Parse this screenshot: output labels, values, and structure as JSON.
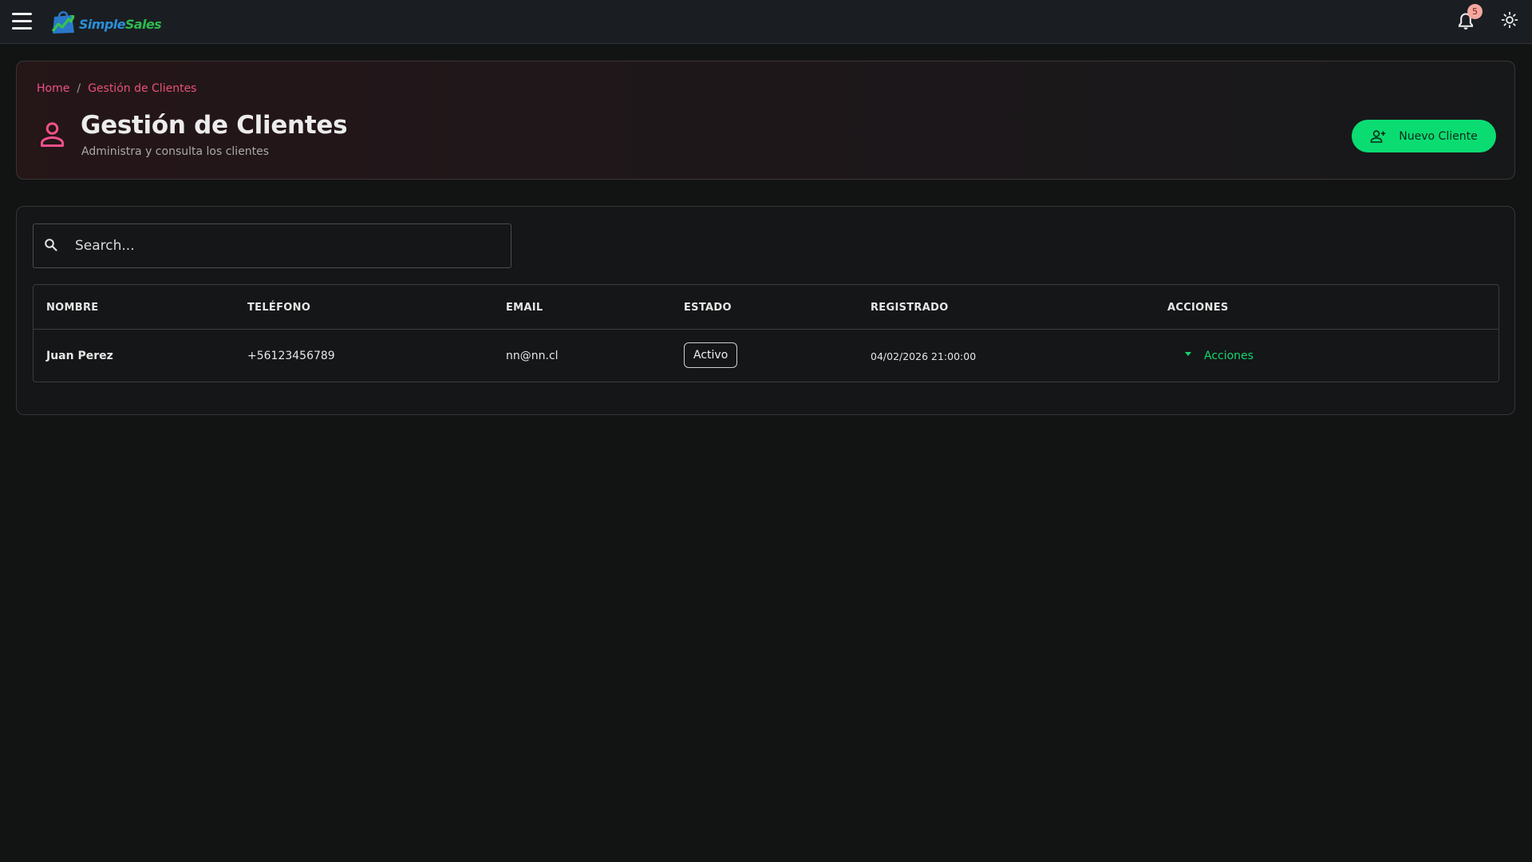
{
  "app": {
    "brand_part1": "Simple",
    "brand_part2": "Sales",
    "notification_count": "5",
    "accent_color": "#0bdc72",
    "brand_pink": "#f0508a"
  },
  "breadcrumb": {
    "home": "Home",
    "separator": "/",
    "current": "Gestión de Clientes"
  },
  "header": {
    "title": "Gestión de Clientes",
    "subtitle": "Administra y consulta los clientes",
    "new_button_label": "Nuevo Cliente"
  },
  "search": {
    "placeholder": "Search...",
    "value": ""
  },
  "table": {
    "columns": [
      "NOMBRE",
      "TELÉFONO",
      "EMAIL",
      "ESTADO",
      "REGISTRADO",
      "ACCIONES"
    ],
    "rows": [
      {
        "nombre": "Juan Perez",
        "telefono": "+56123456789",
        "email": "nn@nn.cl",
        "estado": "Activo",
        "registrado": "04/02/2026 21:00:00",
        "acciones": "Acciones"
      }
    ]
  },
  "icons": {
    "menu": "hamburger-menu-icon",
    "notifications": "bell-icon",
    "theme": "sun-icon",
    "page": "person-icon",
    "add_user": "person-add-icon",
    "search": "search-icon",
    "dropdown": "caret-down-icon"
  }
}
